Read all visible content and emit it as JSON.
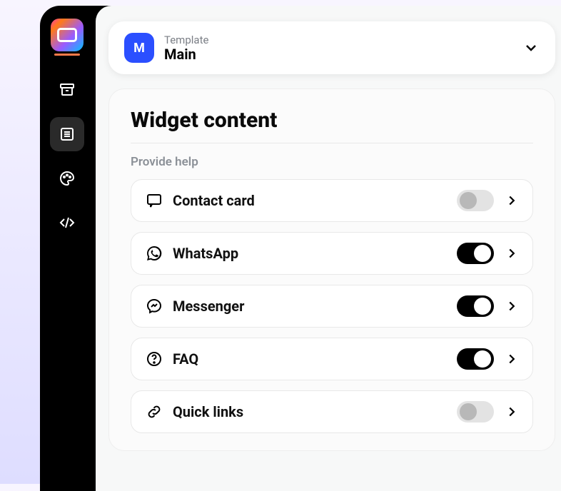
{
  "sidebar": {
    "app_badge": "",
    "items": [
      "archive",
      "content",
      "palette",
      "code"
    ],
    "active_index": 1
  },
  "template": {
    "badge_letter": "M",
    "eyebrow": "Template",
    "name": "Main"
  },
  "content": {
    "title": "Widget content",
    "section_label": "Provide help",
    "rows": [
      {
        "icon": "chat-icon",
        "label": "Contact card",
        "enabled": false
      },
      {
        "icon": "whatsapp-icon",
        "label": "WhatsApp",
        "enabled": true
      },
      {
        "icon": "messenger-icon",
        "label": "Messenger",
        "enabled": true
      },
      {
        "icon": "faq-icon",
        "label": "FAQ",
        "enabled": true
      },
      {
        "icon": "link-icon",
        "label": "Quick links",
        "enabled": false
      }
    ]
  }
}
